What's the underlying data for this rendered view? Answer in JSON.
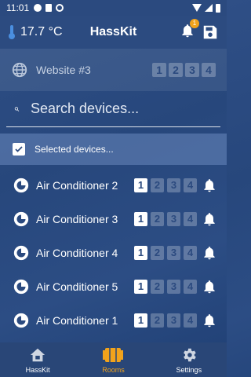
{
  "status_bar": {
    "time": "11:01"
  },
  "header": {
    "temperature": "17.7 °C",
    "title": "HassKit",
    "notification_count": "1"
  },
  "website": {
    "label": "Website #3",
    "buttons": [
      "1",
      "2",
      "3",
      "4"
    ]
  },
  "search": {
    "placeholder": "Search devices..."
  },
  "selected": {
    "label": "Selected devices..."
  },
  "devices": [
    {
      "name": "Air Conditioner 2",
      "buttons": [
        "1",
        "2",
        "3",
        "4"
      ]
    },
    {
      "name": "Air Conditioner 3",
      "buttons": [
        "1",
        "2",
        "3",
        "4"
      ]
    },
    {
      "name": "Air Conditioner 4",
      "buttons": [
        "1",
        "2",
        "3",
        "4"
      ]
    },
    {
      "name": "Air Conditioner 5",
      "buttons": [
        "1",
        "2",
        "3",
        "4"
      ]
    },
    {
      "name": "Air Conditioner 1",
      "buttons": [
        "1",
        "2",
        "3",
        "4"
      ]
    }
  ],
  "bottom_nav": [
    {
      "label": "HassKit",
      "icon": "home-icon",
      "active": false
    },
    {
      "label": "Rooms",
      "icon": "rooms-icon",
      "active": true
    },
    {
      "label": "Settings",
      "icon": "gear-icon",
      "active": false
    }
  ],
  "colors": {
    "accent": "#f2a31b",
    "background": "#2b4a7f",
    "button_text": "#2b4a7f"
  }
}
